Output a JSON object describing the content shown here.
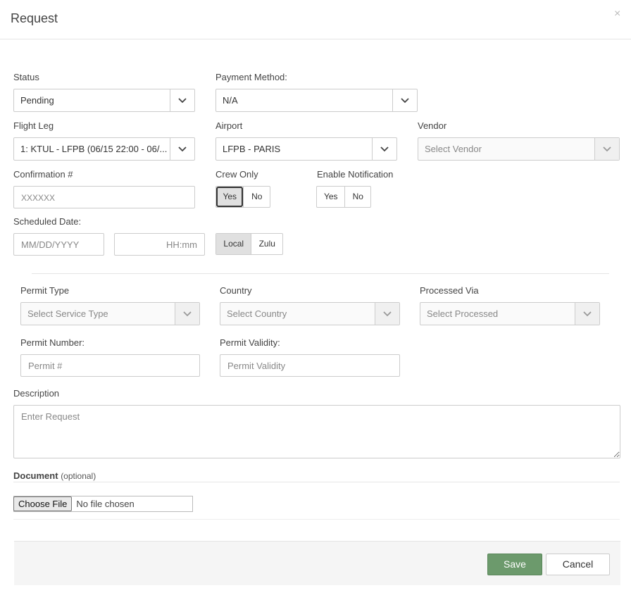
{
  "modal": {
    "title": "Request",
    "close": "×"
  },
  "status": {
    "label": "Status",
    "value": "Pending"
  },
  "payment_method": {
    "label": "Payment Method:",
    "value": "N/A"
  },
  "flight_leg": {
    "label": "Flight Leg",
    "value": "1: KTUL - LFPB (06/15 22:00 - 06/..."
  },
  "airport": {
    "label": "Airport",
    "value": "LFPB - PARIS"
  },
  "vendor": {
    "label": "Vendor",
    "placeholder": "Select Vendor"
  },
  "confirmation": {
    "label": "Confirmation #",
    "placeholder": "XXXXXX"
  },
  "crew_only": {
    "label": "Crew Only",
    "options": [
      "Yes",
      "No"
    ],
    "selected": "Yes"
  },
  "enable_notification": {
    "label": "Enable Notification",
    "options": [
      "Yes",
      "No"
    ]
  },
  "scheduled_date": {
    "label": "Scheduled Date:",
    "date_placeholder": "MM/DD/YYYY",
    "time_placeholder": "HH:mm",
    "timezone_options": [
      "Local",
      "Zulu"
    ],
    "timezone_selected": "Local"
  },
  "permit_type": {
    "label": "Permit Type",
    "placeholder": "Select Service Type"
  },
  "country": {
    "label": "Country",
    "placeholder": "Select Country"
  },
  "processed_via": {
    "label": "Processed Via",
    "placeholder": "Select Processed"
  },
  "permit_number": {
    "label": "Permit Number:",
    "placeholder": "Permit #"
  },
  "permit_validity": {
    "label": "Permit Validity:",
    "placeholder": "Permit Validity"
  },
  "description": {
    "label": "Description",
    "placeholder": "Enter Request"
  },
  "document": {
    "label": "Document",
    "optional": "(optional)",
    "choose_file": "Choose File",
    "no_file": "No file chosen"
  },
  "footer": {
    "save": "Save",
    "cancel": "Cancel"
  },
  "colors": {
    "save_bg": "#6c9a6c",
    "border": "#cccccc",
    "footer_bg": "#f5f5f5"
  }
}
